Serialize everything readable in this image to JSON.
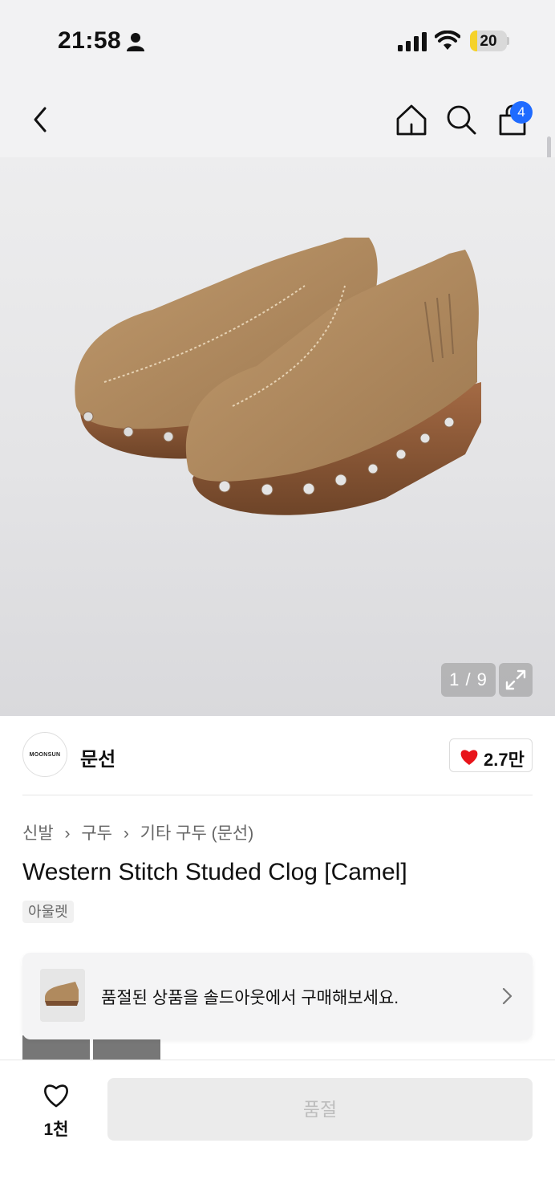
{
  "status_bar": {
    "time": "21:58",
    "battery_percent": "20",
    "battery_level": 0.2,
    "icons": [
      "person-icon",
      "signal-icon",
      "wifi-icon",
      "battery-icon"
    ]
  },
  "nav": {
    "icons": [
      "chevron-left-icon",
      "home-icon",
      "search-icon",
      "shopping-bag-icon"
    ],
    "cart_count": "4"
  },
  "gallery": {
    "image_desc_icon": "shoe-image",
    "counter": "1 / 9",
    "current_index": 1,
    "total": 9
  },
  "brand": {
    "logo_text": "MOONSUN",
    "name": "문선",
    "like_count": "2.7만",
    "heart_color": "#e8141a"
  },
  "product": {
    "breadcrumb": [
      "신발",
      "구두",
      "기타 구두 (문선)"
    ],
    "title": "Western Stitch Studed Clog [Camel]",
    "tag": "아울렛"
  },
  "soldout_banner": {
    "text": "품절된 상품을 솔드아웃에서 구매해보세요."
  },
  "bottom_bar": {
    "wishlist_count": "1천",
    "cta_label": "품절"
  },
  "colors": {
    "badge_blue": "#1f6bff",
    "battery_yellow": "#f5d22a",
    "camel": "#b08a5e"
  }
}
